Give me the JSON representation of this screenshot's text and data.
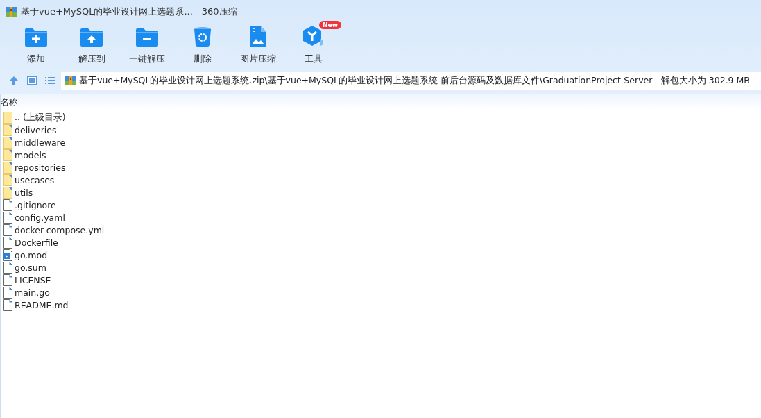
{
  "window": {
    "title": "基于vue+MySQL的毕业设计网上选题系... - 360压缩"
  },
  "toolbar": [
    {
      "kind": "add",
      "label": "添加"
    },
    {
      "kind": "extract",
      "label": "解压到"
    },
    {
      "kind": "oneclick",
      "label": "一键解压"
    },
    {
      "kind": "delete",
      "label": "删除"
    },
    {
      "kind": "image",
      "label": "图片压缩"
    },
    {
      "kind": "tools",
      "label": "工具",
      "badge": "New"
    }
  ],
  "address": {
    "path": "基于vue+MySQL的毕业设计网上选题系统.zip\\基于vue+MySQL的毕业设计网上选题系统 前后台源码及数据库文件\\GraduationProject-Server - 解包大小为 302.9 MB"
  },
  "table": {
    "columns": [
      "名称"
    ],
    "rows": [
      {
        "kind": "parent",
        "name": ".. (上级目录)"
      },
      {
        "kind": "folder",
        "name": "deliveries"
      },
      {
        "kind": "folder",
        "name": "middleware"
      },
      {
        "kind": "folder",
        "name": "models"
      },
      {
        "kind": "folder",
        "name": "repositories"
      },
      {
        "kind": "folder",
        "name": "usecases"
      },
      {
        "kind": "folder",
        "name": "utils"
      },
      {
        "kind": "file",
        "name": ".gitignore"
      },
      {
        "kind": "file",
        "name": "config.yaml"
      },
      {
        "kind": "file",
        "name": "docker-compose.yml"
      },
      {
        "kind": "file",
        "name": "Dockerfile"
      },
      {
        "kind": "media",
        "name": "go.mod"
      },
      {
        "kind": "file",
        "name": "go.sum"
      },
      {
        "kind": "file",
        "name": "LICENSE"
      },
      {
        "kind": "file",
        "name": "main.go"
      },
      {
        "kind": "file",
        "name": "README.md"
      }
    ]
  }
}
